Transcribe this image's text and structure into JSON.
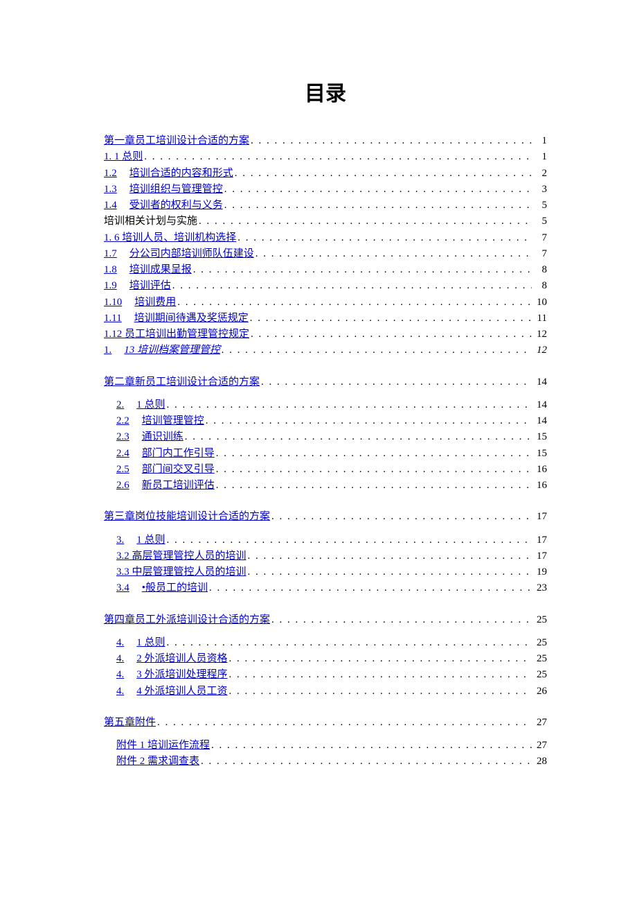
{
  "title": "目录",
  "dots": ". . . . . . . . . . . . . . . . . . . . . . . . . . . . . . . . . . . . . . . . . . . . . . . . . . . . . . . . . . . . . . . . . . . . . . . . . . . . . . . . . . . . . . . . . . . . . . . . . . . . . . . . . . . . . . . . . . . .",
  "groups": [
    {
      "items": [
        {
          "indent": 0,
          "prefix": "",
          "label": "第一章员工培训设计合适的方案",
          "page": "1",
          "link": true,
          "italic": false
        },
        {
          "indent": 0,
          "prefix": "",
          "label": "1. 1 总则",
          "page": "1",
          "link": true,
          "italic": false
        },
        {
          "indent": 0,
          "prefix": "1.2",
          "label": "培训合适的内容和形式",
          "page": "2",
          "link": true,
          "italic": false
        },
        {
          "indent": 0,
          "prefix": "1.3",
          "label": "培训组织与管理管控",
          "page": "3",
          "link": true,
          "italic": false
        },
        {
          "indent": 0,
          "prefix": "1.4",
          "label": "受训者的权利与义务",
          "page": "5",
          "link": true,
          "italic": false
        },
        {
          "indent": 0,
          "prefix": "",
          "label": "培训相关计划与实施",
          "page": "5",
          "link": false,
          "italic": false
        },
        {
          "indent": 0,
          "prefix": "",
          "label": "1. 6 培训人员、培训机构选择",
          "page": "7",
          "link": true,
          "italic": false
        },
        {
          "indent": 0,
          "prefix": "1.7",
          "label": "分公司内部培训师队伍建设",
          "page": "7",
          "link": true,
          "italic": false
        },
        {
          "indent": 0,
          "prefix": "1.8",
          "label": "培训成果呈报",
          "page": "8",
          "link": true,
          "italic": false
        },
        {
          "indent": 0,
          "prefix": "1.9",
          "label": "培训评估",
          "page": "8",
          "link": true,
          "italic": false
        },
        {
          "indent": 0,
          "prefix": "1.10",
          "label": "培训费用",
          "page": "10",
          "link": true,
          "italic": false
        },
        {
          "indent": 0,
          "prefix": "1.11",
          "label": "培训期间待遇及奖惩规定",
          "page": "11",
          "link": true,
          "italic": false
        },
        {
          "indent": 0,
          "prefix": "",
          "label": "1.12 员工培训出勤管理管控规定",
          "page": "12",
          "link": true,
          "italic": false
        },
        {
          "indent": 0,
          "prefix": "1.",
          "label": "13 培训档案管理管控",
          "page": "12",
          "link": true,
          "italic": true
        }
      ]
    },
    {
      "heading": {
        "indent": 0,
        "prefix": "",
        "label": "第二章新员工培训设计合适的方案",
        "page": "14",
        "link": true,
        "italic": false
      },
      "items": [
        {
          "indent": 1,
          "prefix": "2.",
          "label": "1 总则",
          "page": "14",
          "link": true,
          "italic": false
        },
        {
          "indent": 1,
          "prefix": "2.2",
          "label": "培训管理管控",
          "page": "14",
          "link": true,
          "italic": false
        },
        {
          "indent": 1,
          "prefix": "2.3",
          "label": "通识训练",
          "page": "15",
          "link": true,
          "italic": false
        },
        {
          "indent": 1,
          "prefix": "2.4",
          "label": "部门内工作引导",
          "page": "15",
          "link": true,
          "italic": false
        },
        {
          "indent": 1,
          "prefix": "2.5",
          "label": "部门间交叉引导",
          "page": "16",
          "link": true,
          "italic": false
        },
        {
          "indent": 1,
          "prefix": "2.6",
          "label": "新员工培训评估",
          "page": "16",
          "link": true,
          "italic": false
        }
      ]
    },
    {
      "heading": {
        "indent": 0,
        "prefix": "",
        "label": "第三章岗位技能培训设计合适的方案",
        "page": "17",
        "link": true,
        "italic": false
      },
      "items": [
        {
          "indent": 1,
          "prefix": "3.",
          "label": "1 总则",
          "page": "17",
          "link": true,
          "italic": false
        },
        {
          "indent": 1,
          "prefix": "",
          "label": "3.2 高层管理管控人员的培训",
          "page": "17",
          "link": true,
          "italic": false
        },
        {
          "indent": 1,
          "prefix": "",
          "label": "3.3 中层管理管控人员的培训",
          "page": "19",
          "link": true,
          "italic": false
        },
        {
          "indent": 1,
          "prefix": "3.4",
          "label": "   •般员工的培训",
          "page": "23",
          "link": true,
          "italic": false
        }
      ]
    },
    {
      "heading": {
        "indent": 0,
        "prefix": "",
        "label": "第四章员工外派培训设计合适的方案",
        "page": "25",
        "link": true,
        "italic": false
      },
      "items": [
        {
          "indent": 1,
          "prefix": "4.",
          "label": "1 总则",
          "page": "25",
          "link": true,
          "italic": false
        },
        {
          "indent": 1,
          "prefix": "4.",
          "label": "2 外派培训人员资格",
          "page": "25",
          "link": true,
          "italic": false
        },
        {
          "indent": 1,
          "prefix": "4.",
          "label": "3 外派培训处理程序",
          "page": "25",
          "link": true,
          "italic": false
        },
        {
          "indent": 1,
          "prefix": "4.",
          "label": "4 外派培训人员工资",
          "page": "26",
          "link": true,
          "italic": false
        }
      ]
    },
    {
      "heading": {
        "indent": 0,
        "prefix": "",
        "label": "第五章附件",
        "page": "27",
        "link": true,
        "italic": false
      },
      "items": [
        {
          "indent": 1,
          "prefix": "",
          "label": "附件 1 培训运作流程",
          "page": "27",
          "link": true,
          "italic": false
        },
        {
          "indent": 1,
          "prefix": "",
          "label": "附件 2 需求调查表",
          "page": "28",
          "link": true,
          "italic": false
        }
      ]
    }
  ]
}
